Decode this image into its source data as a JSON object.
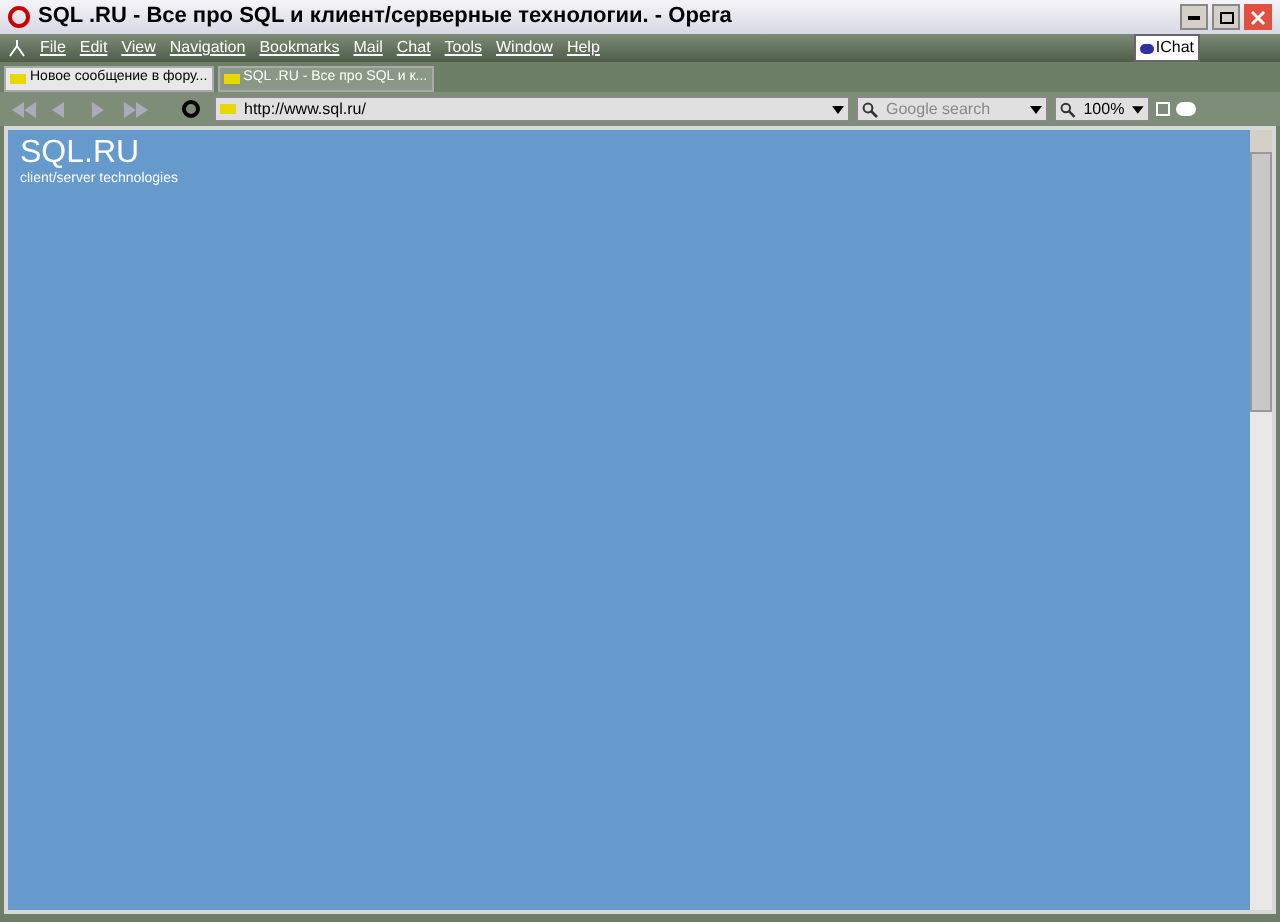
{
  "window": {
    "title": "SQL .RU - Все про SQL и клиент/серверные технологии. - Opera"
  },
  "menu": [
    "File",
    "Edit",
    "View",
    "Navigation",
    "Bookmarks",
    "Mail",
    "Chat",
    "Tools",
    "Window",
    "Help"
  ],
  "chat_badge": "IChat",
  "tabs": [
    {
      "label": "Новое сообщение в фору...",
      "selected": false
    },
    {
      "label": "SQL .RU - Все про SQL и к...",
      "selected": true
    }
  ],
  "address": {
    "value": "http://www.sql.ru/"
  },
  "search": {
    "placeholder": "Google search"
  },
  "zoom": {
    "value": "100%"
  },
  "page": {
    "logo": "SQL.RU",
    "tagline": "client/server technologies"
  }
}
